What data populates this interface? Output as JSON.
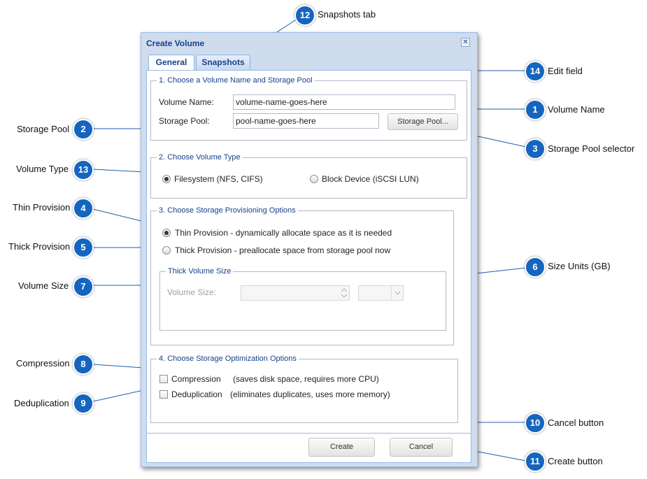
{
  "dialog": {
    "title": "Create Volume",
    "close_glyph": "✕",
    "tabs": [
      {
        "label": "General",
        "active": true
      },
      {
        "label": "Snapshots",
        "active": false
      }
    ],
    "section1": {
      "legend": "1. Choose a Volume Name and Storage Pool",
      "volume_name_label": "Volume Name:",
      "volume_name_value": "volume-name-goes-here",
      "storage_pool_label": "Storage Pool:",
      "storage_pool_value": "pool-name-goes-here",
      "storage_pool_button": "Storage Pool..."
    },
    "section2": {
      "legend": "2. Choose Volume Type",
      "options": [
        {
          "label": "Filesystem (NFS, CIFS)",
          "selected": true
        },
        {
          "label": "Block Device (iSCSI LUN)",
          "selected": false
        }
      ]
    },
    "section3": {
      "legend": "3. Choose Storage Provisioning Options",
      "thin_label": "Thin Provision - dynamically allocate space as it is needed",
      "thin_selected": true,
      "thick_label": "Thick Provision - preallocate space from storage pool now",
      "thick_selected": false,
      "thick_size": {
        "legend": "Thick Volume Size",
        "volume_size_label": "Volume Size:",
        "volume_size_value": "",
        "units_value": ""
      }
    },
    "section4": {
      "legend": "4. Choose Storage Optimization Options",
      "compression_label": "Compression",
      "compression_desc": "(saves disk space, requires more CPU)",
      "compression_checked": false,
      "dedup_label": "Deduplication",
      "dedup_desc": "(eliminates duplicates, uses more memory)",
      "dedup_checked": false
    },
    "footer": {
      "create_label": "Create",
      "cancel_label": "Cancel"
    }
  },
  "callouts": [
    {
      "num": "1",
      "label": "Volume Name"
    },
    {
      "num": "2",
      "label": "Storage Pool"
    },
    {
      "num": "3",
      "label": "Storage Pool selector"
    },
    {
      "num": "4",
      "label": "Thin Provision"
    },
    {
      "num": "5",
      "label": "Thick Provision"
    },
    {
      "num": "6",
      "label": "Size Units (GB)"
    },
    {
      "num": "7",
      "label": "Volume Size"
    },
    {
      "num": "8",
      "label": "Compression"
    },
    {
      "num": "9",
      "label": "Deduplication"
    },
    {
      "num": "10",
      "label": "Cancel button"
    },
    {
      "num": "11",
      "label": "Create button"
    },
    {
      "num": "12",
      "label": "Snapshots tab"
    },
    {
      "num": "13",
      "label": "Volume Type"
    },
    {
      "num": "14",
      "label": "Edit field"
    }
  ],
  "colors": {
    "badge": "#1565c0",
    "dialog_title": "#15428b",
    "frame": "#cfdcee"
  }
}
